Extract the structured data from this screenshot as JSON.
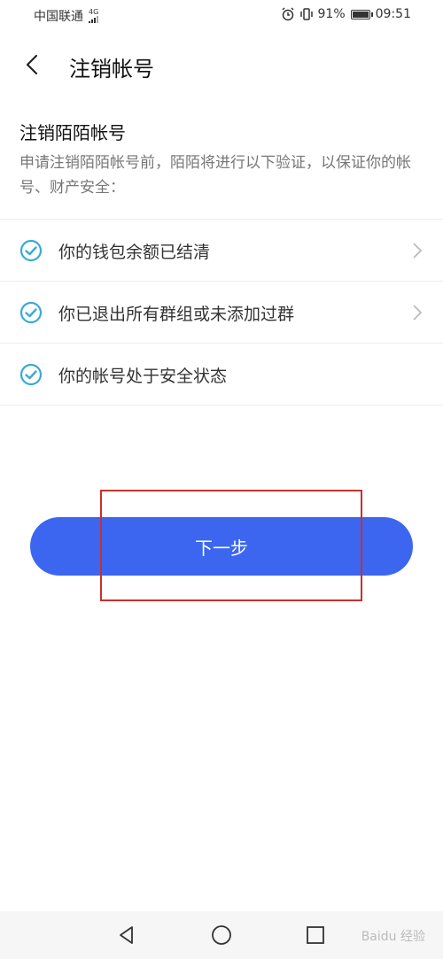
{
  "status_bar": {
    "carrier": "中国联通",
    "network": "4G",
    "battery_percent": "91%",
    "battery_level": 0.91,
    "time": "09:51"
  },
  "header": {
    "title": "注销帐号"
  },
  "intro": {
    "title": "注销陌陌帐号",
    "description": "申请注销陌陌帐号前，陌陌将进行以下验证，以保证你的帐号、财产安全："
  },
  "checks": [
    {
      "label": "你的钱包余额已结清",
      "has_arrow": true
    },
    {
      "label": "你已退出所有群组或未添加过群",
      "has_arrow": true
    },
    {
      "label": "你的帐号处于安全状态",
      "has_arrow": false
    }
  ],
  "actions": {
    "next_label": "下一步"
  },
  "colors": {
    "primary": "#3c66f0",
    "check": "#3aa9d6",
    "highlight": "#c9302c"
  },
  "watermark": "Baidu 经验"
}
